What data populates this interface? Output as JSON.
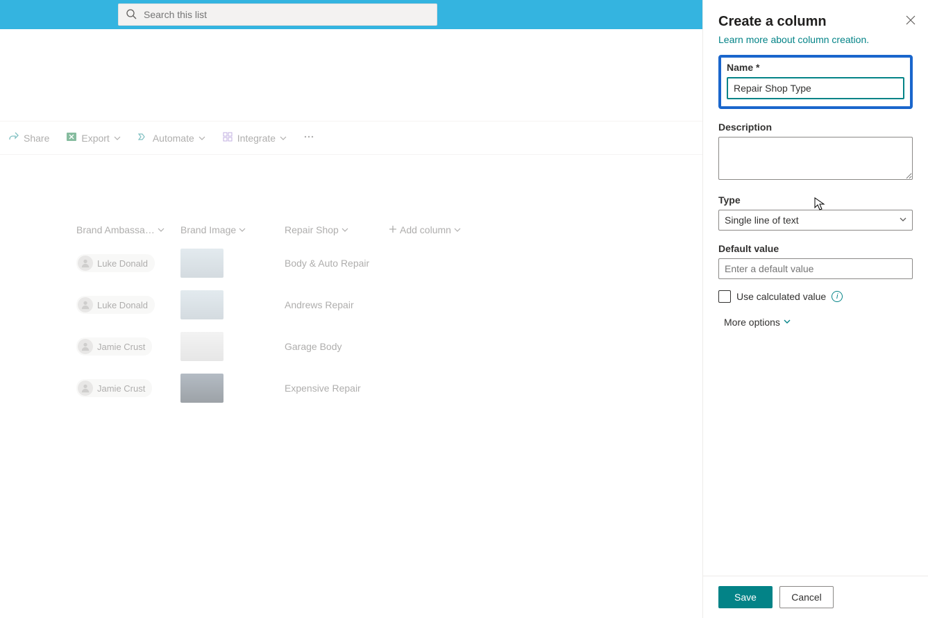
{
  "search": {
    "placeholder": "Search this list"
  },
  "commandbar": {
    "share": "Share",
    "export": "Export",
    "automate": "Automate",
    "integrate": "Integrate"
  },
  "columns": {
    "brand_ambassador": "Brand Ambassa…",
    "brand_image": "Brand Image",
    "repair_shop": "Repair Shop",
    "add_column": "Add column"
  },
  "rows": [
    {
      "ambassador": "Luke Donald",
      "repair_shop": "Body & Auto Repair"
    },
    {
      "ambassador": "Luke Donald",
      "repair_shop": "Andrews Repair"
    },
    {
      "ambassador": "Jamie Crust",
      "repair_shop": "Garage Body"
    },
    {
      "ambassador": "Jamie Crust",
      "repair_shop": "Expensive Repair"
    }
  ],
  "panel": {
    "title": "Create a column",
    "learn_more": "Learn more about column creation.",
    "name_label": "Name *",
    "name_value": "Repair Shop Type",
    "description_label": "Description",
    "description_value": "",
    "type_label": "Type",
    "type_value": "Single line of text",
    "default_value_label": "Default value",
    "default_value_placeholder": "Enter a default value",
    "calculated_label": "Use calculated value",
    "more_options": "More options",
    "save": "Save",
    "cancel": "Cancel"
  }
}
